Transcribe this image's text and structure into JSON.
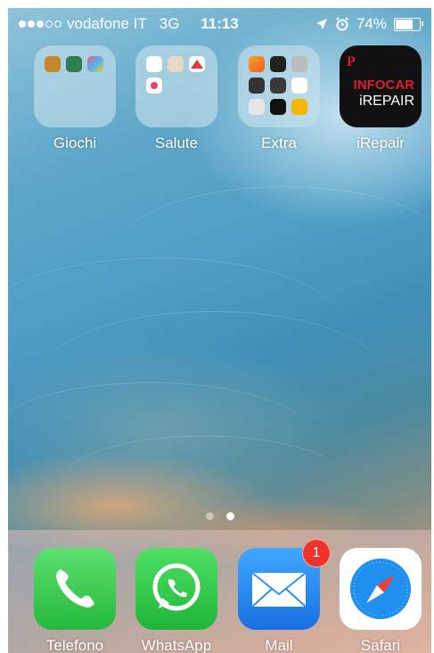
{
  "status_bar": {
    "carrier": "vodafone IT",
    "network": "3G",
    "time": "11:13",
    "battery_percent": "74%",
    "battery_level": 0.74
  },
  "home": {
    "apps": [
      {
        "label": "Giochi"
      },
      {
        "label": "Salute"
      },
      {
        "label": "Extra"
      },
      {
        "label": "iRepair",
        "icon_text": {
          "line1": "INFOCAR",
          "line2": "iREPAIR",
          "mark": "P"
        }
      }
    ],
    "page_count": 2,
    "active_page": 2
  },
  "dock": {
    "apps": [
      {
        "label": "Telefono"
      },
      {
        "label": "WhatsApp"
      },
      {
        "label": "Mail",
        "badge": "1"
      },
      {
        "label": "Safari"
      }
    ]
  },
  "colors": {
    "phone_green": "#3fd35a",
    "whatsapp_green": "#2ecb46",
    "mail_blue": "#2e8ff0",
    "badge_red": "#f0332a",
    "irepair_red": "#d8202a"
  }
}
